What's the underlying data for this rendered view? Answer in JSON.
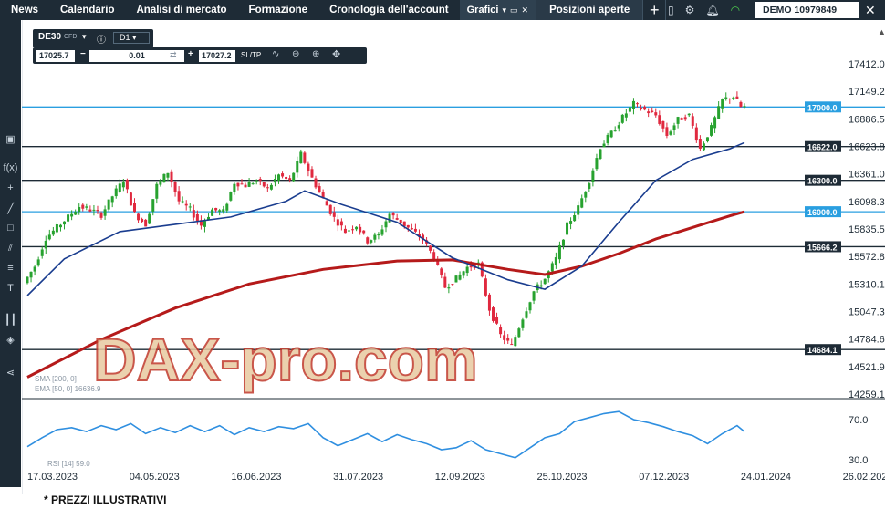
{
  "topbar": {
    "nav": [
      "News",
      "Calendario",
      "Analisi di mercato",
      "Formazione",
      "Cronologia dell'account"
    ],
    "active_tab": "Grafici",
    "second_tab": "Posizioni aperte",
    "account_label": "DEMO",
    "account_number": "10979849"
  },
  "instrument": {
    "symbol": "DE30",
    "type": "CFD",
    "timeframe": "D1",
    "sell_price": "17025.7",
    "lot": "0.01",
    "buy_price": "17027.2",
    "sltp": "SL/TP"
  },
  "watermark": "DAX-pro.com",
  "footer": "* PREZZI ILLUSTRATIVI",
  "colors": {
    "bull": "#27a22f",
    "bear": "#e0293f",
    "sma": "#b51a1a",
    "ema": "#1a3d8f",
    "rsi": "#2f8fe0",
    "level_dark": "#1e2b36",
    "level_blue": "#2a9fe0"
  },
  "chart_data": {
    "type": "candlestick",
    "symbol": "DE30",
    "timeframe": "D1",
    "x_dates": [
      "17.03.2023",
      "04.05.2023",
      "16.06.2023",
      "31.07.2023",
      "12.09.2023",
      "25.10.2023",
      "07.12.2023",
      "24.01.2024",
      "26.02.2024"
    ],
    "y_ticks": [
      "17412.0",
      "17149.2",
      "16886.5",
      "16623.8",
      "16361.0",
      "16098.3",
      "15835.5",
      "15572.8",
      "15310.1",
      "15047.3",
      "14784.6",
      "14521.9",
      "14259.1"
    ],
    "ylim": [
      14259.1,
      17412.0
    ],
    "levels": [
      {
        "value": "17000.0",
        "style": "blue"
      },
      {
        "value": "16622.0",
        "style": "dark"
      },
      {
        "value": "16300.0",
        "style": "dark"
      },
      {
        "value": "16000.0",
        "style": "blue"
      },
      {
        "value": "15666.2",
        "style": "dark"
      },
      {
        "value": "14684.1",
        "style": "dark"
      }
    ],
    "price_path": [
      [
        0,
        15320
      ],
      [
        6,
        15480
      ],
      [
        12,
        15750
      ],
      [
        18,
        15850
      ],
      [
        24,
        15950
      ],
      [
        30,
        16050
      ],
      [
        36,
        16020
      ],
      [
        42,
        15970
      ],
      [
        48,
        16150
      ],
      [
        54,
        16300
      ],
      [
        60,
        15980
      ],
      [
        66,
        15880
      ],
      [
        72,
        16250
      ],
      [
        78,
        16380
      ],
      [
        84,
        16100
      ],
      [
        90,
        16020
      ],
      [
        96,
        15870
      ],
      [
        102,
        16020
      ],
      [
        108,
        16000
      ],
      [
        114,
        16280
      ],
      [
        120,
        16250
      ],
      [
        126,
        16300
      ],
      [
        132,
        16220
      ],
      [
        138,
        16350
      ],
      [
        144,
        16290
      ],
      [
        150,
        16550
      ],
      [
        156,
        16320
      ],
      [
        162,
        16120
      ],
      [
        168,
        15940
      ],
      [
        174,
        15810
      ],
      [
        180,
        15870
      ],
      [
        186,
        15720
      ],
      [
        192,
        15780
      ],
      [
        198,
        15980
      ],
      [
        204,
        15900
      ],
      [
        210,
        15820
      ],
      [
        216,
        15740
      ],
      [
        222,
        15560
      ],
      [
        228,
        15280
      ],
      [
        234,
        15360
      ],
      [
        240,
        15470
      ],
      [
        246,
        15500
      ],
      [
        252,
        15070
      ],
      [
        258,
        14820
      ],
      [
        264,
        14720
      ],
      [
        270,
        14990
      ],
      [
        276,
        15240
      ],
      [
        282,
        15360
      ],
      [
        288,
        15550
      ],
      [
        294,
        15870
      ],
      [
        300,
        16040
      ],
      [
        306,
        16300
      ],
      [
        312,
        16620
      ],
      [
        318,
        16750
      ],
      [
        324,
        16900
      ],
      [
        330,
        17030
      ],
      [
        336,
        16970
      ],
      [
        342,
        16920
      ],
      [
        348,
        16730
      ],
      [
        354,
        16880
      ],
      [
        360,
        16920
      ],
      [
        366,
        16600
      ],
      [
        372,
        16800
      ],
      [
        378,
        17070
      ],
      [
        384,
        17100
      ],
      [
        388,
        17000
      ]
    ],
    "ema50_path": [
      [
        0,
        15200
      ],
      [
        20,
        15550
      ],
      [
        50,
        15810
      ],
      [
        80,
        15880
      ],
      [
        110,
        15950
      ],
      [
        140,
        16100
      ],
      [
        150,
        16200
      ],
      [
        170,
        16070
      ],
      [
        200,
        15900
      ],
      [
        230,
        15560
      ],
      [
        260,
        15350
      ],
      [
        280,
        15260
      ],
      [
        300,
        15480
      ],
      [
        320,
        15900
      ],
      [
        340,
        16300
      ],
      [
        360,
        16500
      ],
      [
        380,
        16600
      ],
      [
        388,
        16660
      ]
    ],
    "sma200_path": [
      [
        0,
        14420
      ],
      [
        40,
        14780
      ],
      [
        80,
        15080
      ],
      [
        120,
        15310
      ],
      [
        160,
        15450
      ],
      [
        200,
        15530
      ],
      [
        230,
        15540
      ],
      [
        260,
        15450
      ],
      [
        280,
        15400
      ],
      [
        300,
        15480
      ],
      [
        320,
        15600
      ],
      [
        340,
        15740
      ],
      [
        360,
        15850
      ],
      [
        380,
        15960
      ],
      [
        388,
        16000
      ]
    ],
    "indicator_labels": [
      "SMA [200, 0]",
      "EMA [50, 0] 16636.9"
    ],
    "rsi": {
      "label": "RSI [14] 59.0",
      "ticks": [
        "70.0",
        "30.0"
      ],
      "path": [
        [
          0,
          43
        ],
        [
          8,
          52
        ],
        [
          16,
          60
        ],
        [
          24,
          62
        ],
        [
          32,
          58
        ],
        [
          40,
          64
        ],
        [
          48,
          60
        ],
        [
          56,
          66
        ],
        [
          64,
          56
        ],
        [
          72,
          62
        ],
        [
          80,
          57
        ],
        [
          88,
          64
        ],
        [
          96,
          58
        ],
        [
          104,
          64
        ],
        [
          112,
          55
        ],
        [
          120,
          62
        ],
        [
          128,
          58
        ],
        [
          136,
          63
        ],
        [
          144,
          61
        ],
        [
          152,
          66
        ],
        [
          160,
          52
        ],
        [
          168,
          44
        ],
        [
          176,
          50
        ],
        [
          184,
          56
        ],
        [
          192,
          48
        ],
        [
          200,
          55
        ],
        [
          208,
          50
        ],
        [
          216,
          46
        ],
        [
          224,
          40
        ],
        [
          232,
          42
        ],
        [
          240,
          49
        ],
        [
          248,
          40
        ],
        [
          256,
          36
        ],
        [
          264,
          32
        ],
        [
          272,
          42
        ],
        [
          280,
          52
        ],
        [
          288,
          56
        ],
        [
          296,
          68
        ],
        [
          304,
          72
        ],
        [
          312,
          76
        ],
        [
          320,
          78
        ],
        [
          328,
          70
        ],
        [
          336,
          67
        ],
        [
          344,
          63
        ],
        [
          352,
          58
        ],
        [
          360,
          54
        ],
        [
          368,
          46
        ],
        [
          376,
          56
        ],
        [
          384,
          64
        ],
        [
          388,
          58
        ]
      ]
    }
  }
}
